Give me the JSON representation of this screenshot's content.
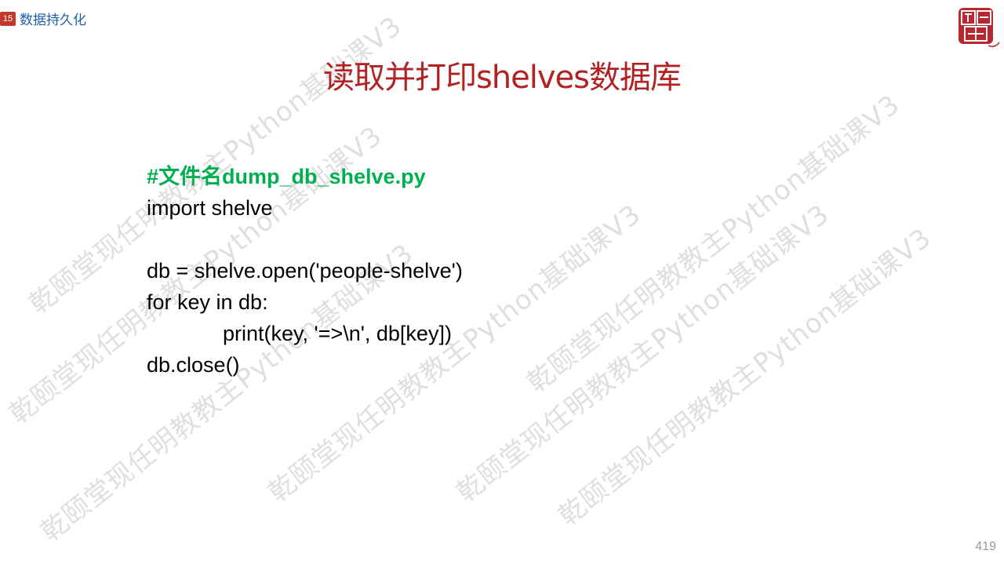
{
  "header": {
    "section_number": "15",
    "section_title": "数据持久化"
  },
  "title": "读取并打印shelves数据库",
  "code": {
    "comment": "#文件名dump_db_shelve.py",
    "lines": [
      "import shelve",
      "",
      "db = shelve.open('people-shelve')",
      "for key in db:",
      "print(key, '=>\\n', db[key])",
      "db.close()"
    ]
  },
  "watermark": {
    "text": "乾颐堂现任明教教主Python基础课V3"
  },
  "page_number": "419",
  "colors": {
    "title": "#b22222",
    "comment": "#00b050",
    "section_badge": "#c0392b",
    "section_title": "#1f5fa8"
  }
}
